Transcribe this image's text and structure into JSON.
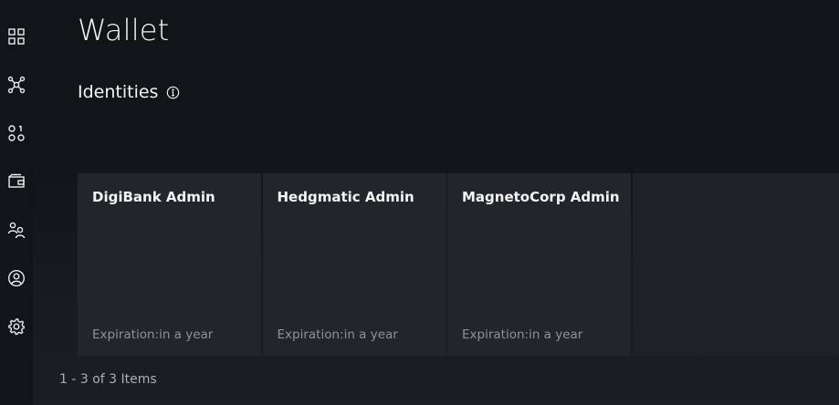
{
  "sidebar": {
    "items": [
      {
        "icon": "dashboard-icon"
      },
      {
        "icon": "network-nodes-icon"
      },
      {
        "icon": "smart-contracts-icon"
      },
      {
        "icon": "wallet-icon"
      },
      {
        "icon": "users-icon"
      },
      {
        "icon": "user-profile-icon"
      },
      {
        "icon": "settings-icon"
      }
    ]
  },
  "page": {
    "title": "Wallet",
    "section_title": "Identities"
  },
  "identities": [
    {
      "name": "DigiBank Admin",
      "expiration": "Expiration:in a year"
    },
    {
      "name": "Hedgmatic Admin",
      "expiration": "Expiration:in a year"
    },
    {
      "name": "MagnetoCorp Admin",
      "expiration": "Expiration:in a year"
    }
  ],
  "pagination": {
    "text": "1 - 3 of 3 Items"
  },
  "colors": {
    "background": "#121417",
    "tile": "#22262b",
    "text": "#f4f4f4",
    "muted": "#8d939a"
  }
}
